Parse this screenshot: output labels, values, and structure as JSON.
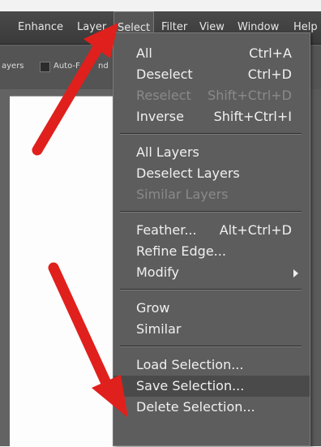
{
  "menubar": {
    "items": [
      "Enhance",
      "Layer",
      "Select",
      "Filter",
      "View",
      "Window",
      "Help"
    ],
    "active_index": 2
  },
  "options_bar": {
    "layers_label": "ayers",
    "auto_label": "Auto-F",
    "obscured_text": "nd"
  },
  "select_menu": {
    "groups": [
      [
        {
          "label": "All",
          "shortcut": "Ctrl+A",
          "disabled": false
        },
        {
          "label": "Deselect",
          "shortcut": "Ctrl+D",
          "disabled": false
        },
        {
          "label": "Reselect",
          "shortcut": "Shift+Ctrl+D",
          "disabled": true
        },
        {
          "label": "Inverse",
          "shortcut": "Shift+Ctrl+I",
          "disabled": false
        }
      ],
      [
        {
          "label": "All Layers",
          "shortcut": "",
          "disabled": false
        },
        {
          "label": "Deselect Layers",
          "shortcut": "",
          "disabled": false
        },
        {
          "label": "Similar Layers",
          "shortcut": "",
          "disabled": true
        }
      ],
      [
        {
          "label": "Feather...",
          "shortcut": "Alt+Ctrl+D",
          "disabled": false
        },
        {
          "label": "Refine Edge...",
          "shortcut": "",
          "disabled": false
        },
        {
          "label": "Modify",
          "shortcut": "",
          "disabled": false,
          "submenu": true
        }
      ],
      [
        {
          "label": "Grow",
          "shortcut": "",
          "disabled": false
        },
        {
          "label": "Similar",
          "shortcut": "",
          "disabled": false
        }
      ],
      [
        {
          "label": "Load Selection...",
          "shortcut": "",
          "disabled": false
        },
        {
          "label": "Save Selection...",
          "shortcut": "",
          "disabled": false,
          "highlighted": true
        },
        {
          "label": "Delete Selection...",
          "shortcut": "",
          "disabled": false
        }
      ]
    ]
  },
  "annotation_color": "#e0201c"
}
